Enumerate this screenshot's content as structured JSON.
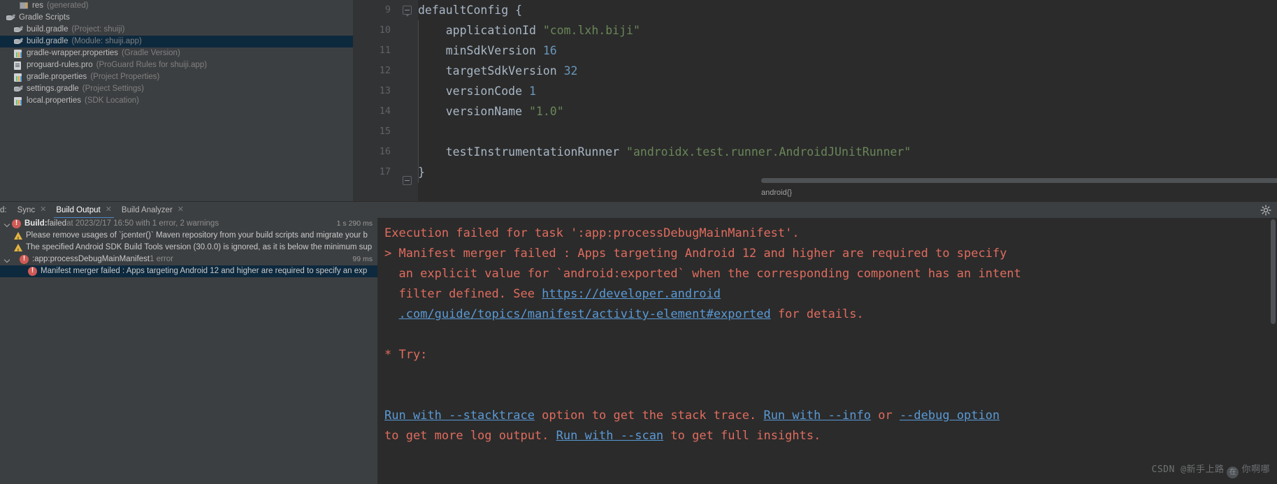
{
  "project_tree": {
    "items": [
      {
        "indent": 22,
        "icon": "folder-icon",
        "name": "res",
        "note": "(generated)",
        "selected": false
      },
      {
        "indent": 3,
        "icon": "gradle-icon",
        "name": "Gradle Scripts",
        "note": "",
        "selected": false
      },
      {
        "indent": 14,
        "icon": "gradle-icon",
        "name": "build.gradle",
        "note": "(Project: shuiji)",
        "selected": false
      },
      {
        "indent": 14,
        "icon": "gradle-icon",
        "name": "build.gradle",
        "note": "(Module: shuiji.app)",
        "selected": true
      },
      {
        "indent": 14,
        "icon": "properties-icon",
        "name": "gradle-wrapper.properties",
        "note": "(Gradle Version)",
        "selected": false
      },
      {
        "indent": 14,
        "icon": "proguard-icon",
        "name": "proguard-rules.pro",
        "note": "(ProGuard Rules for shuiji.app)",
        "selected": false
      },
      {
        "indent": 14,
        "icon": "properties-icon",
        "name": "gradle.properties",
        "note": "(Project Properties)",
        "selected": false
      },
      {
        "indent": 14,
        "icon": "gradle-icon",
        "name": "settings.gradle",
        "note": "(Project Settings)",
        "selected": false
      },
      {
        "indent": 14,
        "icon": "properties-icon",
        "name": "local.properties",
        "note": "(SDK Location)",
        "selected": false
      }
    ]
  },
  "editor": {
    "line_numbers": [
      "9",
      "10",
      "11",
      "12",
      "13",
      "14",
      "15",
      "16",
      "17"
    ],
    "breadcrumb": "android{}",
    "lines": [
      {
        "num": "9",
        "tokens": [
          {
            "t": "defaultConfig {",
            "c": "fn"
          }
        ]
      },
      {
        "num": "10",
        "tokens": [
          {
            "t": "    applicationId ",
            "c": "pl"
          },
          {
            "t": "\"com.lxh.biji\"",
            "c": "str"
          }
        ]
      },
      {
        "num": "11",
        "tokens": [
          {
            "t": "    minSdkVersion ",
            "c": "pl"
          },
          {
            "t": "16",
            "c": "num"
          }
        ]
      },
      {
        "num": "12",
        "tokens": [
          {
            "t": "    targetSdkVersion ",
            "c": "pl"
          },
          {
            "t": "32",
            "c": "num"
          }
        ]
      },
      {
        "num": "13",
        "tokens": [
          {
            "t": "    versionCode ",
            "c": "pl"
          },
          {
            "t": "1",
            "c": "num"
          }
        ]
      },
      {
        "num": "14",
        "tokens": [
          {
            "t": "    versionName ",
            "c": "pl"
          },
          {
            "t": "\"1.0\"",
            "c": "str"
          }
        ]
      },
      {
        "num": "15",
        "tokens": [
          {
            "t": "",
            "c": "pl"
          }
        ]
      },
      {
        "num": "16",
        "tokens": [
          {
            "t": "    testInstrumentationRunner ",
            "c": "pl"
          },
          {
            "t": "\"androidx.test.runner.AndroidJUnitRunner\"",
            "c": "str"
          }
        ]
      },
      {
        "num": "17",
        "tokens": [
          {
            "t": "}",
            "c": "pl"
          }
        ]
      }
    ]
  },
  "build_window": {
    "tab_prefix": "d:",
    "tabs": [
      {
        "label": "Sync",
        "active": false,
        "closable": true
      },
      {
        "label": "Build Output",
        "active": true,
        "closable": true
      },
      {
        "label": "Build Analyzer",
        "active": false,
        "closable": true
      }
    ],
    "settings_icon": "gear-icon",
    "tree": [
      {
        "indent": 0,
        "chevron": true,
        "icon": "error-icon",
        "selected": false,
        "parts": [
          {
            "t": "Build:",
            "c": "bt-strong"
          },
          {
            "t": " failed",
            "c": "bt-txt"
          },
          {
            "t": " at 2023/2/17 16:50 with 1 error, 2 warnings",
            "c": "bt-dim"
          }
        ],
        "time": "1 s 290 ms"
      },
      {
        "indent": 20,
        "chevron": false,
        "icon": "warning-icon",
        "selected": false,
        "parts": [
          {
            "t": "Please remove usages of `jcenter()` Maven repository from your build scripts and migrate your b",
            "c": "bt-txt"
          }
        ],
        "time": ""
      },
      {
        "indent": 20,
        "chevron": false,
        "icon": "warning-icon",
        "selected": false,
        "parts": [
          {
            "t": "The specified Android SDK Build Tools version (30.0.0) is ignored, as it is below the minimum sup",
            "c": "bt-txt"
          }
        ],
        "time": ""
      },
      {
        "indent": 11,
        "chevron": true,
        "icon": "error-icon",
        "selected": false,
        "parts": [
          {
            "t": ":app:processDebugMainManifest",
            "c": "bt-txt"
          },
          {
            "t": "  1 error",
            "c": "bt-dim"
          }
        ],
        "time": "99 ms"
      },
      {
        "indent": 40,
        "chevron": false,
        "icon": "error-icon",
        "selected": true,
        "parts": [
          {
            "t": "Manifest merger failed : Apps targeting Android 12 and higher are required to specify an exp",
            "c": "bt-txt"
          }
        ],
        "time": ""
      }
    ],
    "console": [
      {
        "segs": [
          {
            "t": "Execution failed for task ':app:processDebugMainManifest'.",
            "c": "err"
          }
        ]
      },
      {
        "segs": [
          {
            "t": "> Manifest merger failed : Apps targeting Android 12 and higher are required to specify",
            "c": "err"
          }
        ]
      },
      {
        "segs": [
          {
            "t": "  an explicit value for `android:exported` when the corresponding component has an intent",
            "c": "err"
          }
        ]
      },
      {
        "segs": [
          {
            "t": "  filter defined. See ",
            "c": "err"
          },
          {
            "t": "https://developer.android",
            "c": "lnk"
          }
        ]
      },
      {
        "segs": [
          {
            "t": "  ",
            "c": "err"
          },
          {
            "t": ".com/guide/topics/manifest/activity-element#exported",
            "c": "lnk"
          },
          {
            "t": " for details.",
            "c": "err"
          }
        ]
      },
      {
        "segs": [
          {
            "t": "",
            "c": "err"
          }
        ]
      },
      {
        "segs": [
          {
            "t": "* Try:",
            "c": "err"
          }
        ]
      },
      {
        "segs": [
          {
            "t": "",
            "c": "err"
          }
        ]
      },
      {
        "segs": [
          {
            "t": "",
            "c": "err"
          }
        ]
      }
    ],
    "console_wrapped": [
      {
        "segs": [
          {
            "t": "Run with --stacktrace",
            "c": "lnk"
          },
          {
            "t": " option to get the stack trace. ",
            "c": "err"
          },
          {
            "t": "Run with --info",
            "c": "lnk"
          },
          {
            "t": " or ",
            "c": "err"
          },
          {
            "t": "--debug option",
            "c": "lnk"
          }
        ]
      },
      {
        "segs": [
          {
            "t": "to get more log output. ",
            "c": "err"
          },
          {
            "t": "Run with --scan",
            "c": "lnk"
          },
          {
            "t": " to get full insights.",
            "c": "err"
          }
        ]
      }
    ]
  },
  "watermark": {
    "text": "CSDN @新手上路",
    "badge": "在",
    "suffix": "你啊哪"
  },
  "colors": {
    "panel_bg": "#3c3f41",
    "editor_bg": "#2b2b2b",
    "selection": "#0d293e",
    "accent": "#4a88c7",
    "error": "#e06c5e",
    "link": "#5a9ad6",
    "string": "#6a8759",
    "number": "#6897bb",
    "warning": "#e3b341",
    "error_badge": "#cf5b56"
  }
}
